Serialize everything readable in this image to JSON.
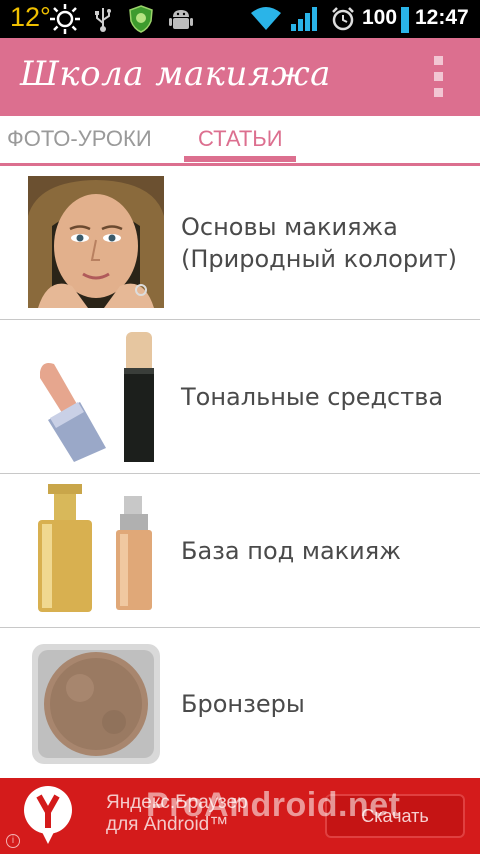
{
  "status_bar": {
    "temperature": "12°",
    "battery_level": "100",
    "time": "12:47",
    "icons": [
      "sun-icon",
      "usb-icon",
      "shield-app-icon",
      "android-debug-icon",
      "wifi-icon",
      "signal-icon",
      "alarm-icon",
      "battery-icon"
    ]
  },
  "app_bar": {
    "title": "Школа макияжа",
    "menu_icon": "overflow-menu-icon",
    "color": "#dc6f8f"
  },
  "tabs": [
    {
      "label": "ФОТО-УРОКИ",
      "selected": false
    },
    {
      "label": "СТАТЬИ",
      "selected": true
    }
  ],
  "articles": [
    {
      "title": "Основы макияжа (Природный колорит)",
      "thumbnail": "face-portrait"
    },
    {
      "title": "Тональные средства",
      "thumbnail": "lipstick-and-concealer"
    },
    {
      "title": "База под макияж",
      "thumbnail": "foundation-bottles"
    },
    {
      "title": "Бронзеры",
      "thumbnail": "bronzer-powder-jar"
    }
  ],
  "ad_banner": {
    "line1": "Яндекс.Браузер",
    "line2": "для Android™",
    "button_label": "Скачать",
    "watermark": "ProAndroid.net",
    "info_glyph": "i",
    "color": "#d41b1b"
  }
}
